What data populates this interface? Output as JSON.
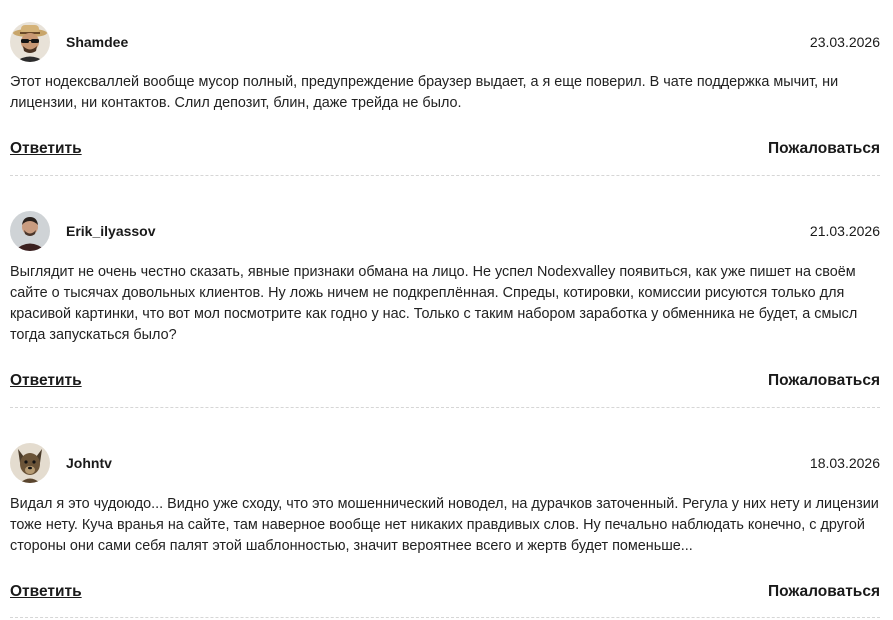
{
  "comments": [
    {
      "author": "Shamdee",
      "date": "23.03.2026",
      "avatar": "avatar-man-sunglasses-hat",
      "text": "Этот нодексваллей вообще мусор полный, предупреждение браузер выдает, а я еще поверил. В чате поддержка мычит, ни лицензии, ни контактов. Слил депозит, блин, даже трейда не было.",
      "reply_label": "Ответить",
      "report_label": "Пожаловаться"
    },
    {
      "author": "Erik_ilyassov",
      "date": "21.03.2026",
      "avatar": "avatar-man-dark-shirt",
      "text": "Выглядит не очень честно сказать, явные признаки обмана на лицо. Не успел Nodexvalley появиться, как уже пишет на своём сайте о тысячах довольных клиентов. Ну ложь ничем не подкреплённая. Спреды, котировки, комиссии рисуются только для красивой картинки, что вот мол посмотрите как годно у нас. Только с таким набором заработка у обменника не будет, а смысл тогда запускаться было?",
      "reply_label": "Ответить",
      "report_label": "Пожаловаться"
    },
    {
      "author": "Johntv",
      "date": "18.03.2026",
      "avatar": "avatar-dog",
      "text": "Видал я это чудоюдо... Видно уже сходу, что это мошеннический новодел, на дурачков заточенный. Регула у них нету и лицензии тоже нету. Куча вранья на сайте, там наверное вообще нет никаких правдивых слов. Ну печально наблюдать конечно, с другой стороны они сами себя палят этой шаблонностью, значит вероятнее всего и жертв будет поменьше...",
      "reply_label": "Ответить",
      "report_label": "Пожаловаться"
    }
  ],
  "colors": {
    "text": "#1a1a1a",
    "divider": "#d6d6d6",
    "background": "#ffffff"
  }
}
